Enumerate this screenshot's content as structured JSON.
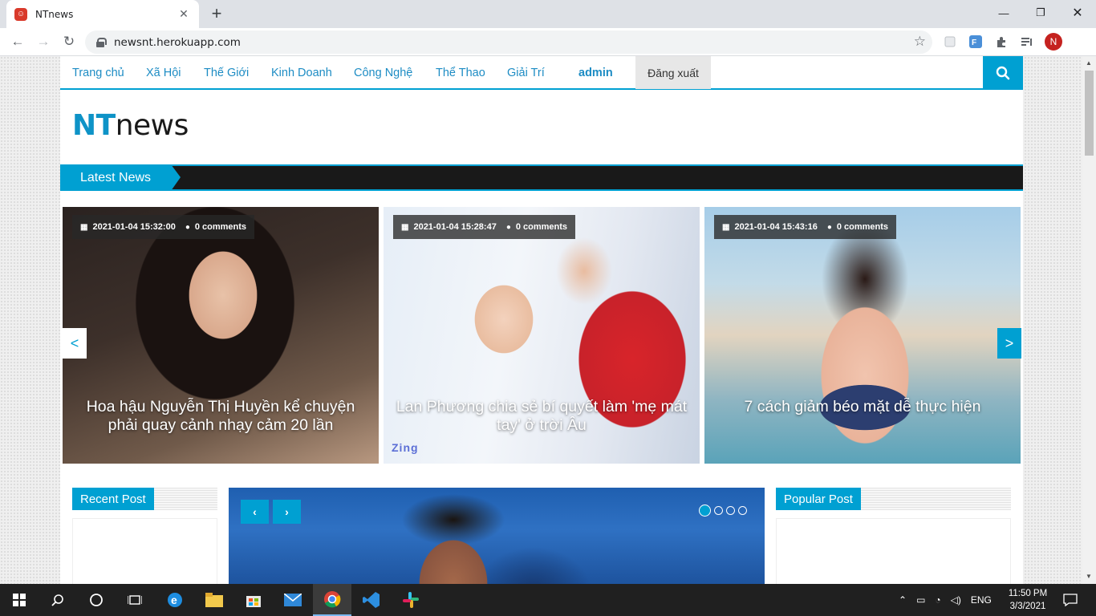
{
  "browser": {
    "tab_title": "NTnews",
    "tab_close": "✕",
    "new_tab": "+",
    "url": "newsnt.herokuapp.com",
    "profile_initial": "N",
    "window_controls": {
      "minimize": "—",
      "maximize": "❐",
      "close": "✕"
    },
    "extensions": [
      "extension-icon",
      "translate-icon",
      "puzzle-icon",
      "media-icon"
    ]
  },
  "site": {
    "nav": {
      "items": [
        "Trang chủ",
        "Xã Hội",
        "Thế Giới",
        "Kinh Doanh",
        "Công Nghệ",
        "Thể Thao",
        "Giải Trí"
      ],
      "user": "admin",
      "logout": "Đăng xuất"
    },
    "logo": {
      "prefix": "NT",
      "suffix": "news"
    },
    "ticker_label": "Latest News",
    "slider": {
      "prev": "<",
      "next": ">",
      "cards": [
        {
          "date": "2021-01-04 15:32:00",
          "comments": "0 comments",
          "title": "Hoa hậu Nguyễn Thị Huyền kể chuyện phải quay cảnh nhạy cảm 20 lần"
        },
        {
          "date": "2021-01-04 15:28:47",
          "comments": "0 comments",
          "title": "Lan Phương chia sẻ bí quyết làm 'mẹ mát tay' ở trời Âu",
          "watermark": "Zing"
        },
        {
          "date": "2021-01-04 15:43:16",
          "comments": "0 comments",
          "title": "7 cách giảm béo mặt dễ thực hiện"
        }
      ]
    },
    "recent_post": "Recent Post",
    "popular_post": "Popular Post",
    "feature_slider": {
      "prev": "‹",
      "next": "›",
      "dots": 4,
      "active_dot": 0
    }
  },
  "taskbar": {
    "language": "ENG",
    "time": "11:50 PM",
    "date": "3/3/2021"
  }
}
